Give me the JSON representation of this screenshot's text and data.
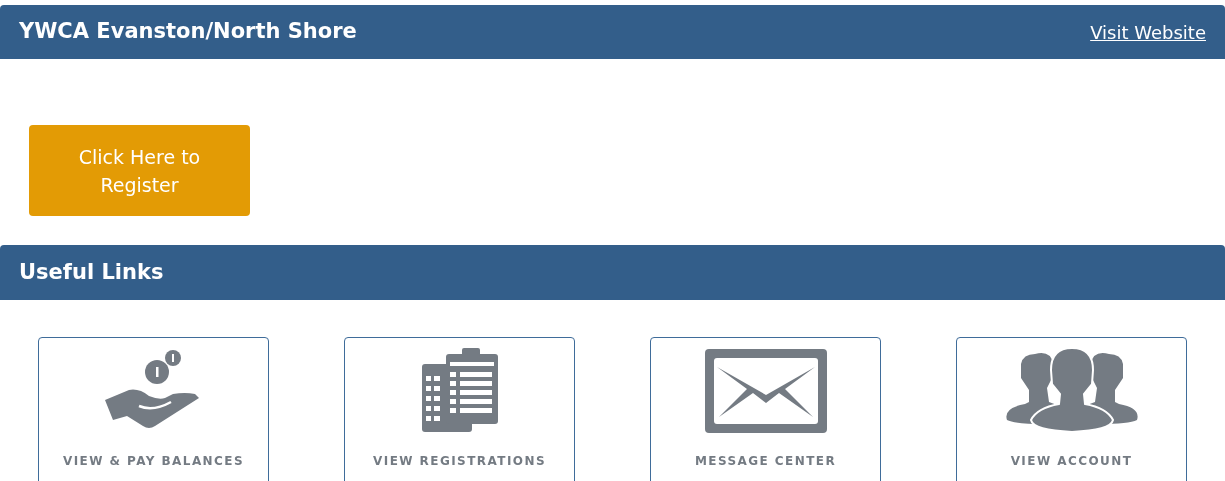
{
  "header": {
    "title": "YWCA Evanston/North Shore",
    "link": "Visit Website"
  },
  "register_button": "Click Here to Register",
  "useful_links": {
    "title": "Useful Links",
    "items": [
      {
        "kind": "balances",
        "label": "VIEW & PAY BALANCES"
      },
      {
        "kind": "registrations",
        "label": "VIEW REGISTRATIONS"
      },
      {
        "kind": "messages",
        "label": "MESSAGE CENTER"
      },
      {
        "kind": "account",
        "label": "VIEW ACCOUNT"
      }
    ]
  }
}
